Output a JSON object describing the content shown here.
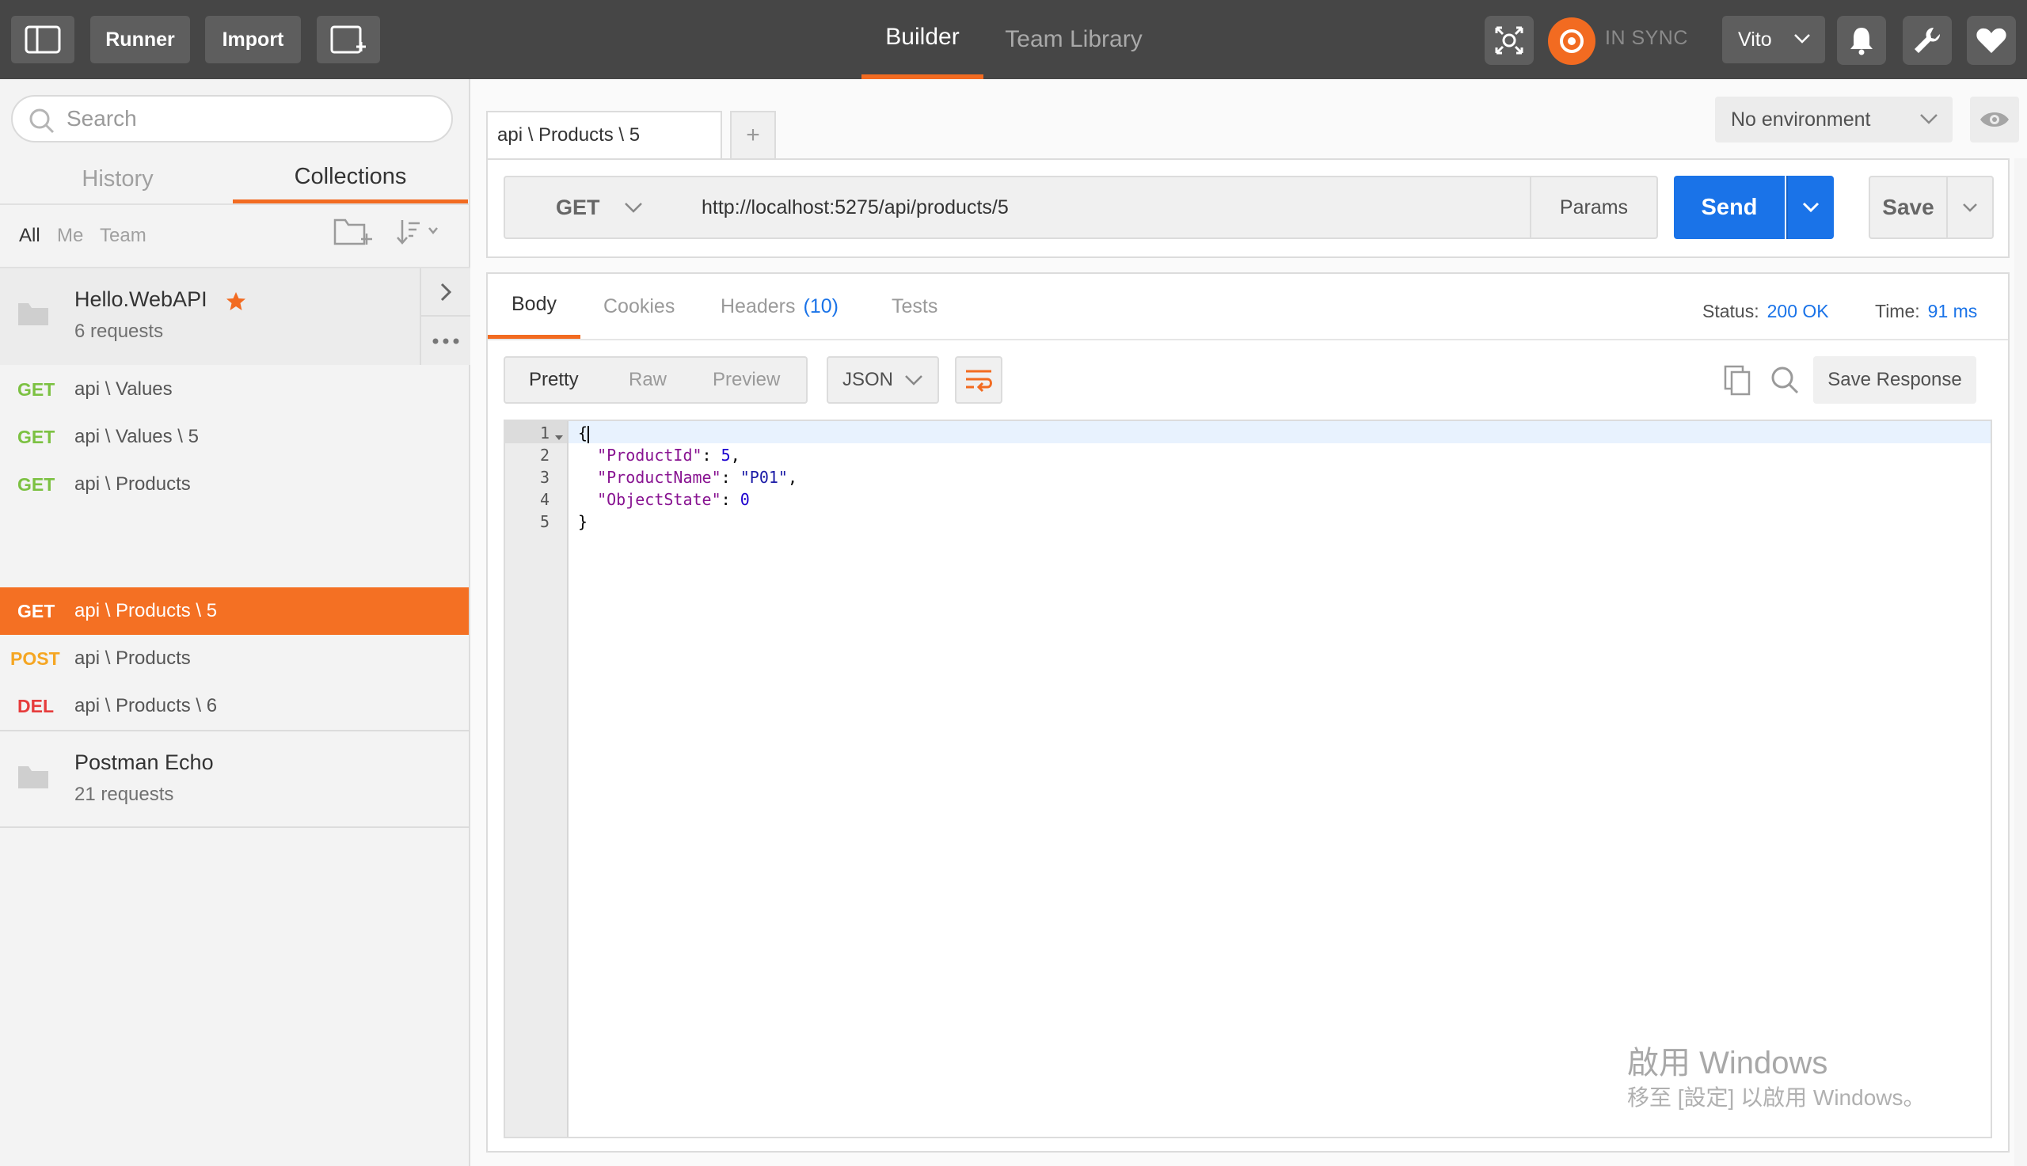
{
  "topbar": {
    "runner_label": "Runner",
    "import_label": "Import",
    "nav_tabs": [
      {
        "label": "Builder",
        "active": true
      },
      {
        "label": "Team Library",
        "active": false
      }
    ],
    "sync_status": "IN SYNC",
    "user_name": "Vito",
    "accent_color": "#f26b21",
    "icons": [
      "sidebar-toggle-icon",
      "new-window-icon",
      "interceptor-icon",
      "sync-icon",
      "bell-icon",
      "wrench-icon",
      "heart-icon"
    ]
  },
  "sidebar": {
    "search_placeholder": "Search",
    "tabs": [
      {
        "label": "History",
        "active": false
      },
      {
        "label": "Collections",
        "active": true
      }
    ],
    "filters": [
      {
        "label": "All",
        "active": true
      },
      {
        "label": "Me",
        "active": false
      },
      {
        "label": "Team",
        "active": false
      }
    ],
    "collections": [
      {
        "name": "Hello.WebAPI",
        "count": "6 requests",
        "starred": true,
        "requests": [
          {
            "method": "GET",
            "path": "api \\ Values"
          },
          {
            "method": "GET",
            "path": "api \\ Values \\ 5"
          },
          {
            "method": "GET",
            "path": "api \\ Products"
          },
          {
            "method": "GET",
            "path": "api \\ Products \\ 5",
            "active": true
          },
          {
            "method": "POST",
            "path": "api \\ Products"
          },
          {
            "method": "DEL",
            "path": "api \\ Products \\ 6"
          }
        ]
      },
      {
        "name": "Postman Echo",
        "count": "21 requests"
      }
    ]
  },
  "main": {
    "request_tab": "api \\ Products \\ 5",
    "add_tab": "+",
    "environment": "No environment",
    "method": "GET",
    "url": "http://localhost:5275/api/products/5",
    "params_label": "Params",
    "send_label": "Send",
    "save_label": "Save",
    "send_color": "#1a73e8"
  },
  "response": {
    "tabs": [
      {
        "label": "Body",
        "active": true
      },
      {
        "label": "Cookies",
        "active": false
      },
      {
        "label": "Headers",
        "count": "(10)",
        "active": false
      },
      {
        "label": "Tests",
        "active": false
      }
    ],
    "status_label": "Status:",
    "status_value": "200 OK",
    "time_label": "Time:",
    "time_value": "91 ms",
    "formats": [
      {
        "label": "Pretty",
        "active": true
      },
      {
        "label": "Raw",
        "active": false
      },
      {
        "label": "Preview",
        "active": false
      }
    ],
    "language": "JSON",
    "save_response_label": "Save Response",
    "line_numbers": [
      "1",
      "2",
      "3",
      "4",
      "5"
    ],
    "code": {
      "l1": "{",
      "l2_key": "\"ProductId\"",
      "l2_sep": ": ",
      "l2_val": "5",
      "l2_end": ",",
      "l3_key": "\"ProductName\"",
      "l3_sep": ": ",
      "l3_val": "\"P01\"",
      "l3_end": ",",
      "l4_key": "\"ObjectState\"",
      "l4_sep": ": ",
      "l4_val": "0",
      "l5": "}"
    }
  },
  "watermark": {
    "line1": "啟用 Windows",
    "line2": "移至 [設定] 以啟用 Windows。"
  }
}
